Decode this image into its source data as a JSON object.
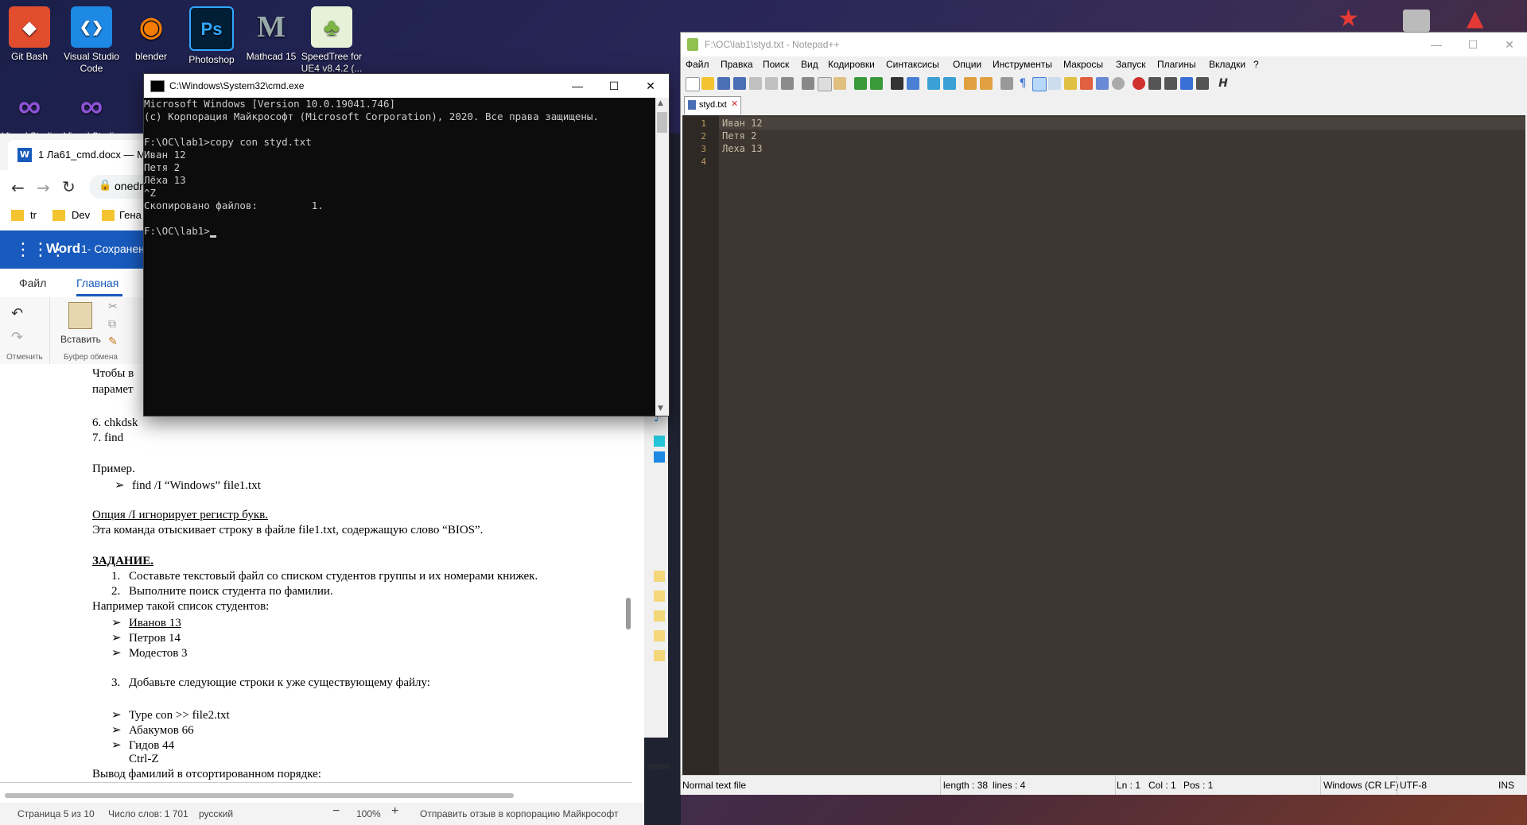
{
  "desktop": {
    "icons": [
      {
        "label": "Git Bash",
        "color": "#e24d2e",
        "glyph": "◆"
      },
      {
        "label": "Visual Studio Code",
        "color": "#1e88e5",
        "glyph": "❮❯"
      },
      {
        "label": "blender",
        "color": "#f57c00",
        "glyph": "◉"
      },
      {
        "label": "Photoshop",
        "color": "#001e36",
        "glyph": "Ps"
      },
      {
        "label": "Mathcad 15",
        "color": "#5a5a5a",
        "glyph": "M"
      },
      {
        "label": "SpeedTree for UE4 v8.4.2 (...",
        "color": "#7cb342",
        "glyph": "♣"
      }
    ],
    "row2": [
      {
        "label": "Visual Studio",
        "color": "#7b3fc4"
      },
      {
        "label": "Visual Studio",
        "color": "#7b3fc4"
      }
    ]
  },
  "browser": {
    "tab_title": "1 Ла61_cmd.docx — Mic",
    "address": "onedr",
    "bookmarks": [
      "tr",
      "Dev",
      "Гена"
    ]
  },
  "word": {
    "app_name": "Word",
    "doc_status": "1- Сохранен",
    "tabs": [
      "Файл",
      "Главная"
    ],
    "ribbon": {
      "undo_group": "Отменить",
      "paste": "Вставить",
      "clipboard_group": "Буфер обмена"
    },
    "lines": [
      "Чтобы в",
      "парамет",
      "6. chkdsk",
      "7. find",
      "Пример.",
      "find /I “Windows” file1.txt",
      "Опция /I игнорирует регистр букв.",
      "Эта команда отыскивает строку в файле file1.txt, содержащую слово “BIOS”.",
      "ЗАДАНИЕ.",
      "Составьте текстовый файл со списком студентов группы и их номерами книжек.",
      "Выполните поиск студента по фамилии.",
      "Например такой список студентов:",
      "Иванов 13",
      "Петров 14",
      "Модестов 3",
      "Добавьте следующие строки к уже существующему файлу:",
      "Type con >> file2.txt",
      "Абакумов 66",
      "Гидов 44",
      "Ctrl-Z",
      "Вывод фамилий в отсортированном порядке:"
    ],
    "status": {
      "page": "Страница 5 из 10",
      "words": "Число слов: 1 701",
      "lang": "русский",
      "zoom": "100%",
      "feedback": "Отправить отзыв в корпорацию Майкрософт"
    }
  },
  "cmd": {
    "title": "C:\\Windows\\System32\\cmd.exe",
    "lines": [
      "Microsoft Windows [Version 10.0.19041.746]",
      "(c) Корпорация Майкрософт (Microsoft Corporation), 2020. Все права защищены.",
      "",
      "F:\\OC\\lab1>copy con styd.txt",
      "Иван 12",
      "Петя 2",
      "Лёха 13",
      "^Z",
      "Скопировано файлов:         1.",
      "",
      "F:\\OC\\lab1>"
    ]
  },
  "notepad": {
    "title": "F:\\OC\\lab1\\styd.txt - Notepad++",
    "menu": [
      "Файл",
      "Правка",
      "Поиск",
      "Вид",
      "Кодировки",
      "Синтаксисы",
      "Опции",
      "Инструменты",
      "Макросы",
      "Запуск",
      "Плагины",
      "Вкладки",
      "?"
    ],
    "tab": "styd.txt",
    "line_numbers": [
      "1",
      "2",
      "3",
      "4"
    ],
    "code_lines": [
      "Иван 12",
      "Петя 2",
      "Леха 13",
      ""
    ],
    "status": {
      "type": "Normal text file",
      "length": "length : 38",
      "lines": "lines : 4",
      "ln": "Ln : 1",
      "col": "Col : 1",
      "pos": "Pos : 1",
      "eol": "Windows (CR LF)",
      "enc": "UTF-8",
      "ins": "INS"
    }
  },
  "explorer_glimpse": {
    "label_ten": "ten",
    "label_elem": "Элем"
  }
}
